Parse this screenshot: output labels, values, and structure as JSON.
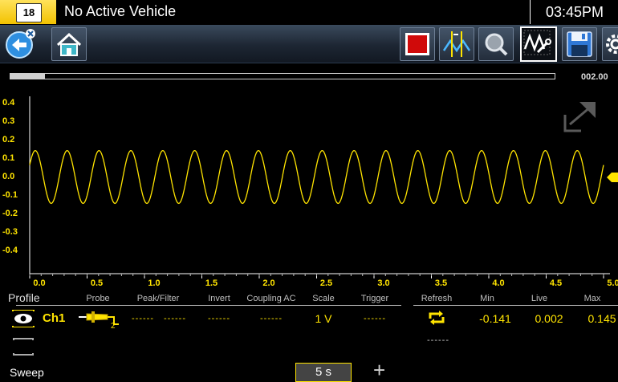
{
  "titlebar": {
    "vehicle_icon_text": "18",
    "title": "No Active Vehicle",
    "clock": "03:45PM"
  },
  "toolbar": {
    "buttons": [
      {
        "name": "back-button",
        "icon": "back-arrow-icon"
      },
      {
        "name": "home-button",
        "icon": "home-icon"
      },
      {
        "name": "stop-record-button",
        "icon": "stop-icon"
      },
      {
        "name": "cursor-button",
        "icon": "cursor-icon"
      },
      {
        "name": "zoom-button",
        "icon": "zoom-icon"
      },
      {
        "name": "scope-settings-button",
        "icon": "waveform-wrench-icon"
      },
      {
        "name": "save-button",
        "icon": "floppy-disk-icon"
      },
      {
        "name": "settings-button",
        "icon": "gear-icon"
      }
    ]
  },
  "buffer": {
    "position_text": "002.00",
    "progress_fraction": 0.064
  },
  "chart_data": {
    "type": "line",
    "y_ticks": [
      "0.4",
      "0.3",
      "0.2",
      "0.1",
      "0.0",
      "-0.1",
      "-0.2",
      "-0.3",
      "-0.4"
    ],
    "x_ticks": [
      "0.0",
      "0.5",
      "1.0",
      "1.5",
      "2.0",
      "2.5",
      "3.0",
      "3.5",
      "4.0",
      "4.5",
      "5.0"
    ],
    "xlim": [
      0,
      5.0
    ],
    "ylim": [
      -0.45,
      0.45
    ],
    "series": [
      {
        "color": "#ffe400",
        "waveform": "sine",
        "cycles": 18,
        "min": -0.141,
        "max": 0.145
      }
    ],
    "grid": false
  },
  "panel": {
    "profile_label": "Profile",
    "headers": {
      "probe": "Probe",
      "peak_filter": "Peak/Filter",
      "invert": "Invert",
      "coupling": "Coupling AC",
      "scale": "Scale",
      "trigger": "Trigger",
      "refresh": "Refresh",
      "min": "Min",
      "live": "Live",
      "max": "Max"
    },
    "ch1": {
      "label": "Ch1",
      "peak": "------",
      "filter": "------",
      "invert": "------",
      "coupling": "------",
      "scale": "1 V",
      "trigger": "------",
      "min": "-0.141",
      "live": "0.002",
      "max": "0.145"
    },
    "ch2": {
      "refresh": "------"
    },
    "sweep_label": "Sweep",
    "sweep_value": "5 s",
    "plus": "+"
  }
}
